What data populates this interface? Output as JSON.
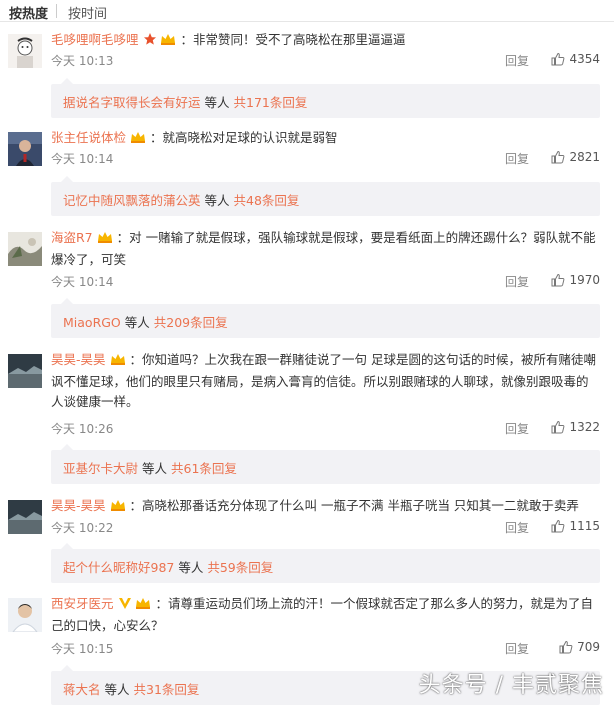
{
  "tabs": {
    "active": "按热度",
    "inactive": "按时间"
  },
  "ui": {
    "reply_label": "回复",
    "sub_mid": "等人"
  },
  "comments": [
    {
      "user": "毛哆哩啊毛哆哩",
      "text": "非常赞同！受不了高晓松在那里逼逼逼",
      "time": "今天 10:13",
      "likes": "4354",
      "sub_user": "据说名字取得长会有好运",
      "sub_count": "共171条回复"
    },
    {
      "user": "张主任说体检",
      "text": "就高晓松对足球的认识就是弱智",
      "time": "今天 10:14",
      "likes": "2821",
      "sub_user": "记忆中随风飘落的蒲公英",
      "sub_count": "共48条回复"
    },
    {
      "user": "海盗R7",
      "text": "对 一赌输了就是假球，强队输球就是假球，要是看纸面上的牌还踢什么？弱队就不能爆冷了，可笑",
      "time": "今天 10:14",
      "likes": "1970",
      "sub_user": "MiaoRGO",
      "sub_count": "共209条回复"
    },
    {
      "user": "昊昊-昊昊",
      "text": "你知道吗？上次我在跟一群赌徒说了一句 足球是圆的这句话的时候，被所有赌徒嘲讽不懂足球，他们的眼里只有赌局，是病入膏肓的信徒。所以别跟赌球的人聊球，就像别跟吸毒的人谈健康一样。",
      "time": "今天 10:26",
      "likes": "1322",
      "sub_user": "亚基尔卡大尉",
      "sub_count": "共61条回复"
    },
    {
      "user": "昊昊-昊昊",
      "text": "高晓松那番话充分体现了什么叫 一瓶子不满 半瓶子咣当 只知其一二就敢于卖弄",
      "time": "今天 10:22",
      "likes": "1115",
      "sub_user": "起个什么昵称好987",
      "sub_count": "共59条回复"
    },
    {
      "user": "西安牙医元",
      "text": "请尊重运动员们场上流的汗！一个假球就否定了那么多人的努力，就是为了自己的口快，心安么？",
      "time": "今天 10:15",
      "likes": "709",
      "sub_user": "蒋大名",
      "sub_count": "共31条回复"
    }
  ],
  "watermark": "头条号 / 丰贰聚焦",
  "colors": {
    "accent": "#eb7350",
    "sub_bg": "#f2f2f5",
    "text": "#333333",
    "meta": "#888888"
  }
}
